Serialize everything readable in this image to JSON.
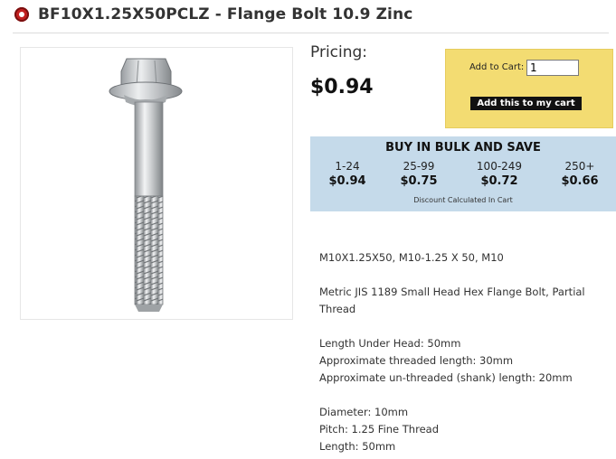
{
  "header": {
    "title": "BF10X1.25X50PCLZ - Flange Bolt 10.9 Zinc",
    "bullet_icon": "red-circle-bullet-icon"
  },
  "product_image": {
    "alt": "Flange bolt photo"
  },
  "pricing": {
    "label": "Pricing:",
    "price": "$0.94"
  },
  "cart": {
    "add_label": "Add to Cart:",
    "quantity": "1",
    "button_label": "Add this to my cart"
  },
  "bulk": {
    "heading": "BUY IN BULK AND SAVE",
    "tiers": [
      {
        "qty": "1-24",
        "price": "$0.94"
      },
      {
        "qty": "25-99",
        "price": "$0.75"
      },
      {
        "qty": "100-249",
        "price": "$0.72"
      },
      {
        "qty": "250+",
        "price": "$0.66"
      }
    ],
    "note": "Discount Calculated In Cart"
  },
  "description": {
    "sizes": "M10X1.25X50, M10-1.25 X 50, M10",
    "summary_line1": "Metric JIS 1189 Small Head Hex Flange Bolt, Partial",
    "summary_line2": "Thread",
    "length_under_head": "Length Under Head: 50mm",
    "threaded_length": "Approximate threaded length: 30mm",
    "unthreaded_length": "Approximate un-threaded (shank) length: 20mm",
    "diameter": "Diameter: 10mm",
    "pitch": "Pitch: 1.25 Fine Thread",
    "length": "Length: 50mm"
  },
  "colors": {
    "cart_box": "#f3dc72",
    "bulk_box": "#c5daea",
    "bullet": "#c21f1f"
  }
}
